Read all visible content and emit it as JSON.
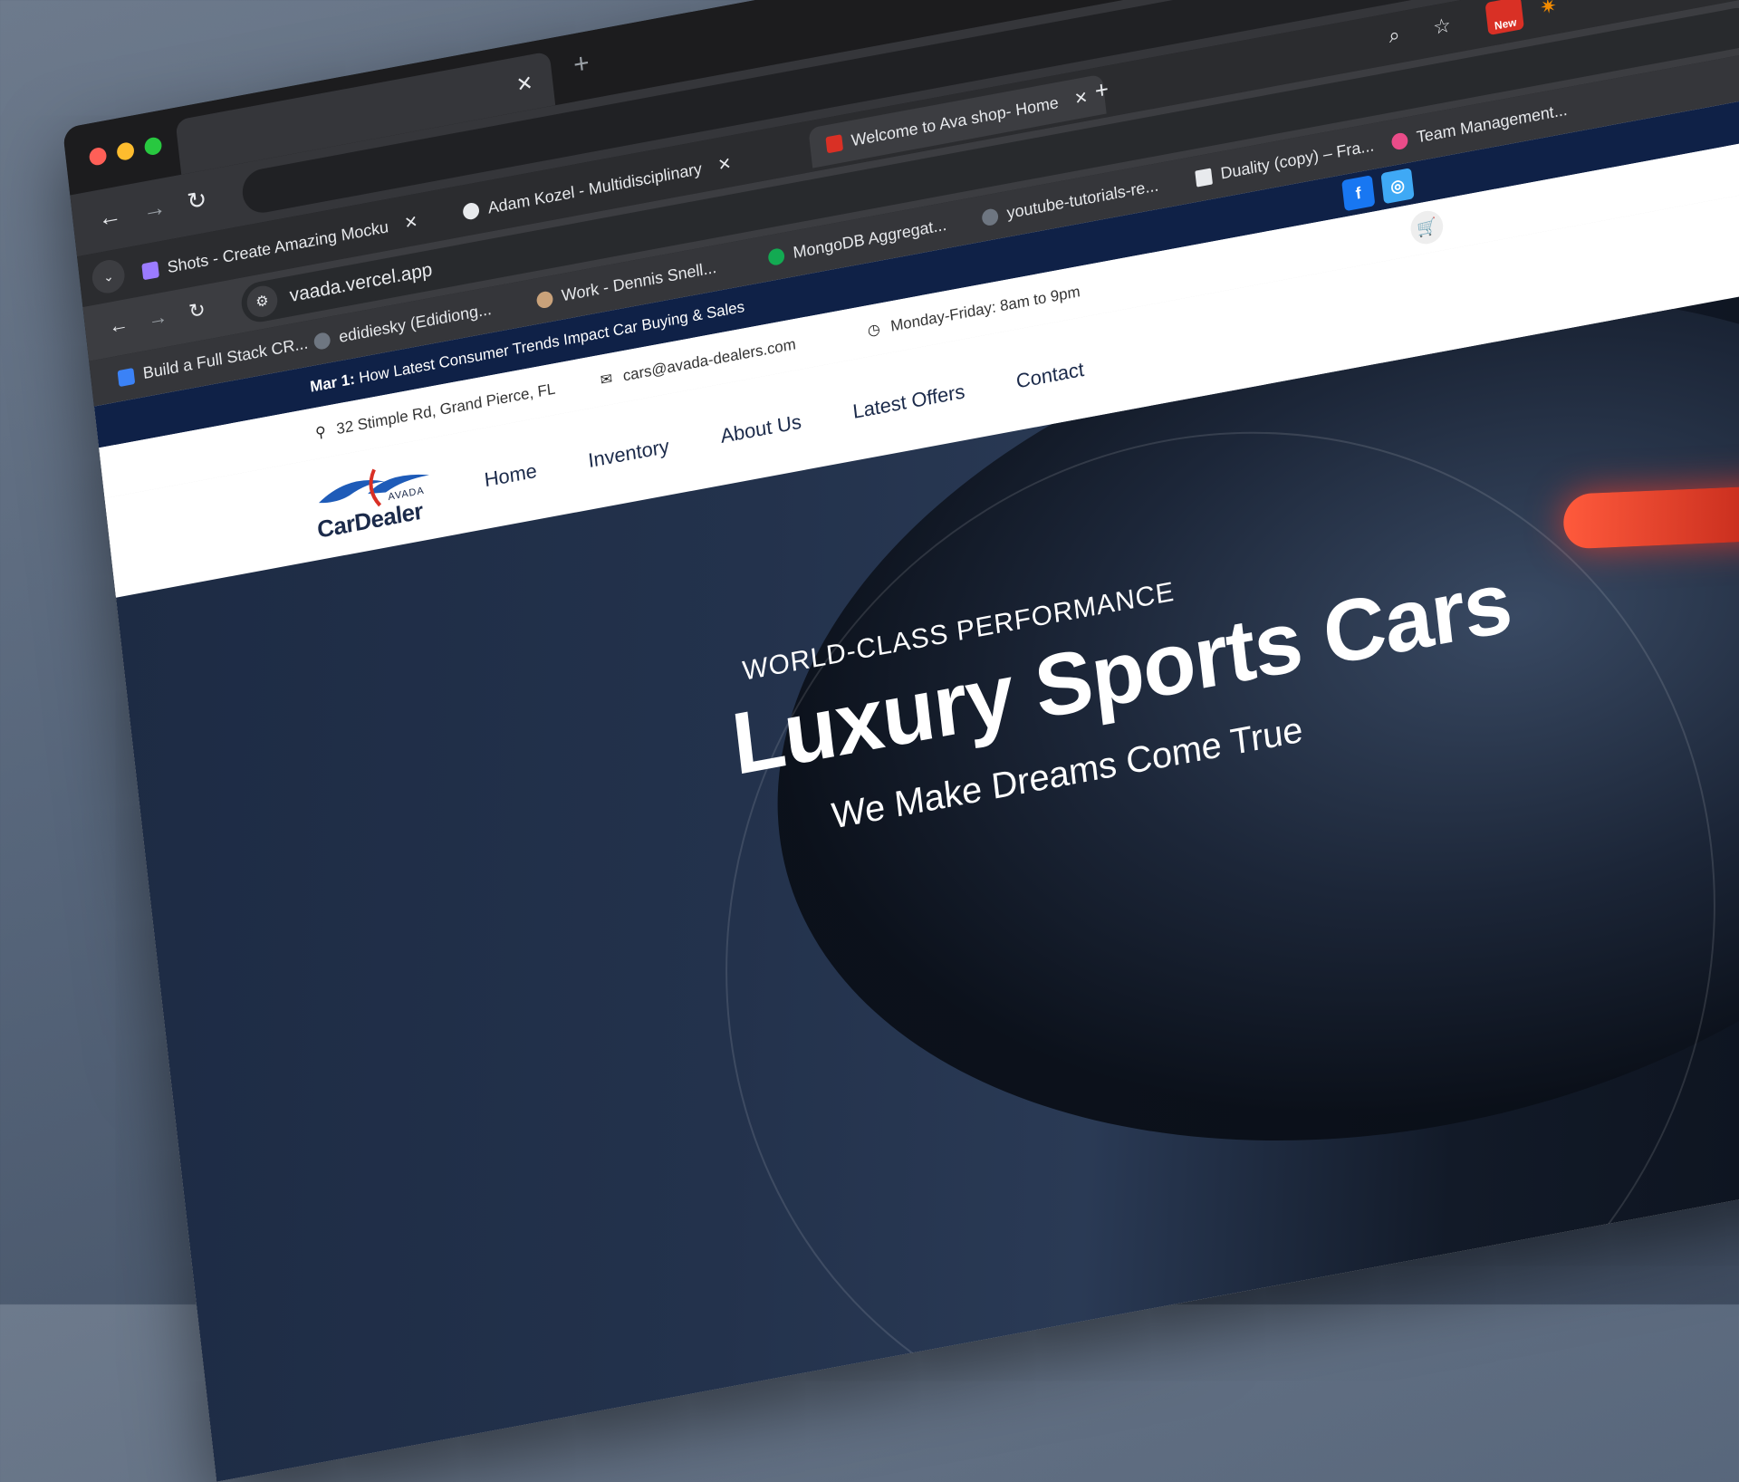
{
  "outer_browser": {
    "tab_close": "✕",
    "new_tab": "+"
  },
  "inner_tabs": [
    {
      "label": "Shots - Create Amazing Mocku",
      "favicon_color": "#9b7bff"
    },
    {
      "label": "Adam Kozel - Multidisciplinary",
      "favicon_color": "#e8eaed"
    },
    {
      "label": "Welcome to Ava shop- Home",
      "favicon_color": "#d93025"
    }
  ],
  "inner_toolbar": {
    "url": "vaada.vercel.app",
    "badge": "New"
  },
  "bookmarks_row1": [
    {
      "label": "Work - Dennis Snell...",
      "icon_color": "#c9a27a"
    },
    {
      "label": "MongoDB Aggregat...",
      "icon_color": "#13aa52"
    },
    {
      "label": "youtube-tutorials-re...",
      "icon_color": "#6e7681"
    },
    {
      "label": "Duality (copy) – Fra...",
      "icon_color": "#e8eaed"
    },
    {
      "label": "Team Management...",
      "icon_color": "#ea4c89"
    }
  ],
  "bookmarks_row2": [
    {
      "label": "Build a Full Stack CR...",
      "icon_color": "#3b82f6"
    },
    {
      "label": "edidiesky (Edidiong...",
      "icon_color": "#6e7681"
    }
  ],
  "site": {
    "news_date": "Mar 1:",
    "news_text": "How Latest Consumer Trends Impact Car Buying & Sales",
    "address": "32 Stimple Rd, Grand Pierce, FL",
    "email": "cars@avada-dealers.com",
    "hours": "Monday-Friday: 8am to 9pm",
    "logo_brand": "AVADA",
    "logo_name": "CarDealer",
    "nav": [
      "Home",
      "Inventory",
      "About Us",
      "Latest Offers",
      "Contact"
    ],
    "hero_kicker": "WORLD-CLASS PERFORMANCE",
    "hero_title": "Luxury Sports Cars",
    "hero_sub": "We Make Dreams Come True",
    "colors": {
      "topbar": "#0f2147",
      "facebook": "#1877f2",
      "instagram": "#3fa9f5",
      "accent_red": "#d93025"
    }
  }
}
